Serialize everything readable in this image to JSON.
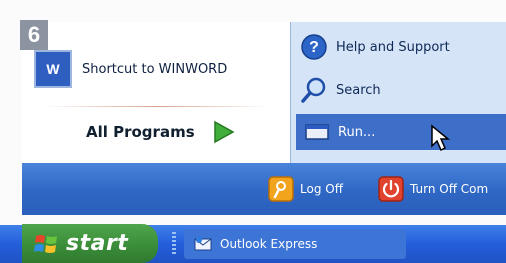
{
  "badge": {
    "number": "6"
  },
  "left_pane": {
    "shortcut_label": "Shortcut to WINWORD",
    "all_programs_label": "All Programs"
  },
  "right_pane": {
    "help_label": "Help and Support",
    "search_label": "Search",
    "run_label": "Run..."
  },
  "bottom_band": {
    "logoff_label": "Log Off",
    "turnoff_label": "Turn Off Com"
  },
  "taskbar": {
    "start_label": "start",
    "task_label": "Outlook Express"
  },
  "icons": [
    "word-icon",
    "arrow-right-icon",
    "help-icon",
    "search-icon",
    "run-icon",
    "logoff-icon",
    "power-icon",
    "windows-logo-icon",
    "outlook-icon",
    "mouse-cursor-icon"
  ]
}
